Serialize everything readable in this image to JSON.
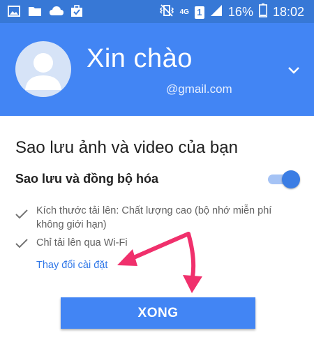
{
  "status_bar": {
    "network_type": "4G",
    "sim_slot": "1",
    "battery_percent": "16%",
    "time": "18:02"
  },
  "header": {
    "greeting": "Xin chào",
    "email": "@gmail.com"
  },
  "content": {
    "title": "Sao lưu ảnh và video của bạn",
    "sync_label": "Sao lưu và đồng bộ hóa",
    "sync_enabled": true,
    "items": [
      {
        "line1": "Kích thước tải lên: Chất lượng cao (bộ nhớ miễn phí",
        "line2": "không giới hạn)"
      },
      {
        "line1": "Chỉ tải lên qua Wi-Fi"
      }
    ],
    "change_settings_link": "Thay đổi cài đặt",
    "done_button": "XONG"
  },
  "colors": {
    "header_bg": "#4285f4",
    "status_bar_bg": "#3778d6",
    "accent": "#4285f4",
    "annotation_arrows": "#f0306c"
  }
}
